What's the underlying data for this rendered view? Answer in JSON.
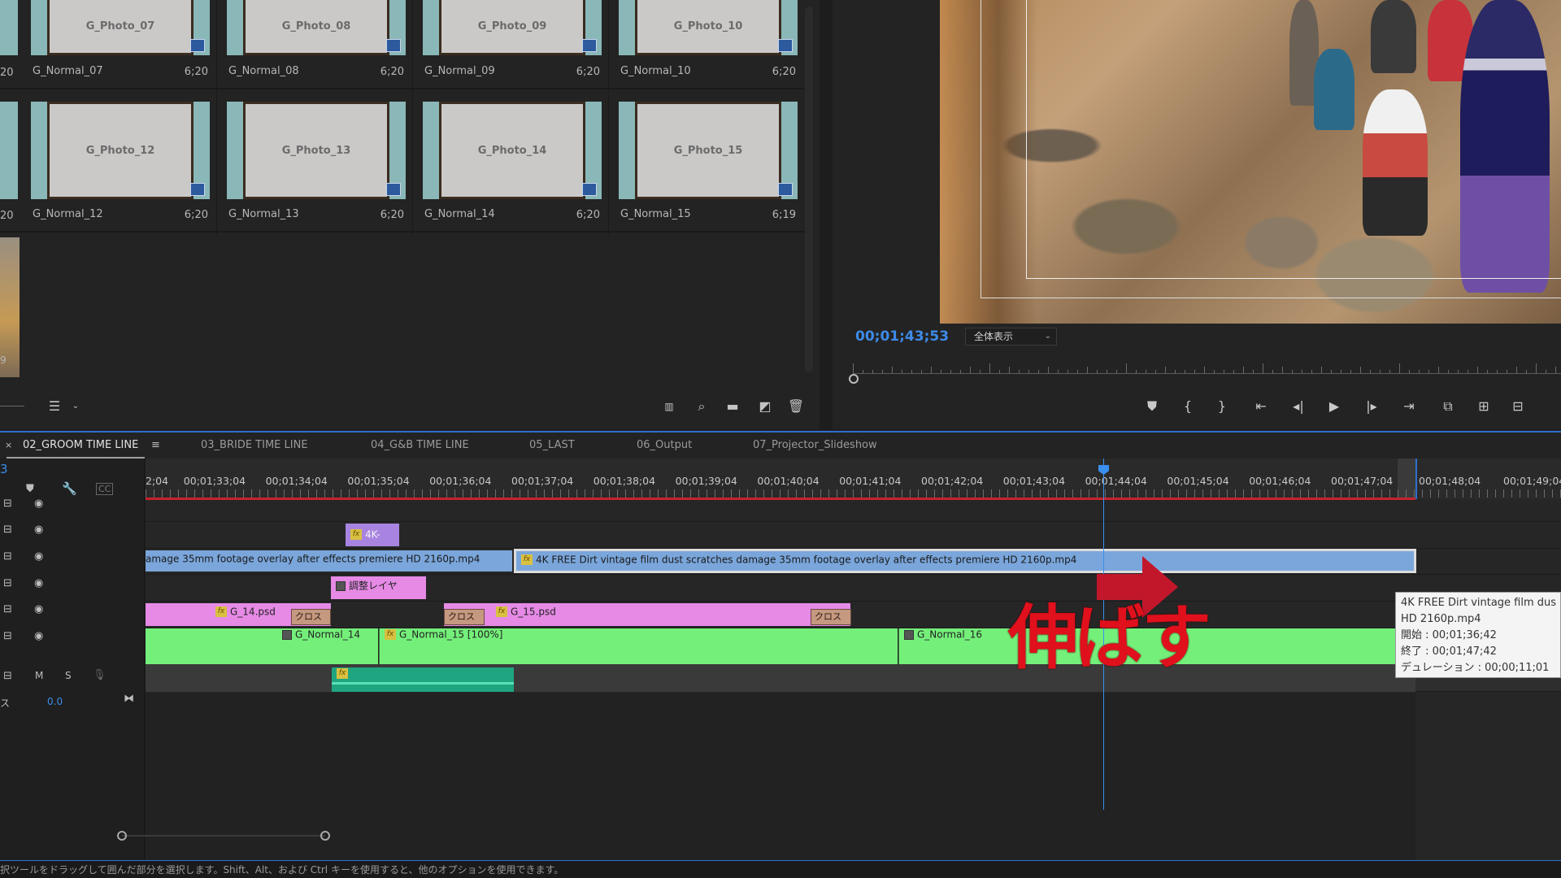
{
  "project_panel": {
    "row1": [
      {
        "photo": "G_Photo_07",
        "name": "G_Normal_07",
        "dur": "6;20"
      },
      {
        "photo": "G_Photo_08",
        "name": "G_Normal_08",
        "dur": "6;20"
      },
      {
        "photo": "G_Photo_09",
        "name": "G_Normal_09",
        "dur": "6;20"
      },
      {
        "photo": "G_Photo_10",
        "name": "G_Normal_10",
        "dur": "6;20"
      }
    ],
    "row2": [
      {
        "photo": "G_Photo_12",
        "name": "G_Normal_12",
        "dur": "6;20"
      },
      {
        "photo": "G_Photo_13",
        "name": "G_Normal_13",
        "dur": "6;20"
      },
      {
        "photo": "G_Photo_14",
        "name": "G_Normal_14",
        "dur": "6;20"
      },
      {
        "photo": "G_Photo_15",
        "name": "G_Normal_15",
        "dur": "6;19"
      }
    ],
    "left_partial": [
      "20",
      "20",
      "9"
    ]
  },
  "program_monitor": {
    "timecode": "00;01;43;53",
    "fit_label": "全体表示"
  },
  "timeline": {
    "tabs": [
      {
        "label": "02_GROOM TIME LINE"
      },
      {
        "label": "03_BRIDE TIME LINE"
      },
      {
        "label": "04_G&B TIME LINE"
      },
      {
        "label": "05_LAST"
      },
      {
        "label": "06_Output"
      },
      {
        "label": "07_Projector_Slideshow"
      }
    ],
    "track_count_label": "3",
    "ruler_labels": [
      "2;04",
      "00;01;33;04",
      "00;01;34;04",
      "00;01;35;04",
      "00;01;36;04",
      "00;01;37;04",
      "00;01;38;04",
      "00;01;39;04",
      "00;01;40;04",
      "00;01;41;04",
      "00;01;42;04",
      "00;01;43;04",
      "00;01;44;04",
      "00;01;45;04",
      "00;01;46;04",
      "00;01;47;04",
      "00;01;48;04",
      "00;01;49;04"
    ],
    "clips": {
      "v6_label": "4K-",
      "v5_left": "amage 35mm footage overlay after effects premiere HD 2160p.mp4",
      "v5_right": "4K FREE Dirt vintage film dust scratches damage 35mm footage overlay after effects premiere HD 2160p.mp4",
      "v4_label": "調整レイヤ",
      "v3_a": "G_14.psd",
      "v3_b": "G_15.psd",
      "trans1": "クロス",
      "trans2": "クロス",
      "trans3": "クロス",
      "v2_a": "G_Normal_14",
      "v2_b": "G_Normal_15 [100%]",
      "v2_c": "G_Normal_16"
    },
    "audio_header": {
      "m": "M",
      "s": "S",
      "volume": "0.0",
      "left_cut": "ス"
    },
    "tooltip": {
      "line1": "4K FREE Dirt vintage film dus",
      "line2": "HD 2160p.mp4",
      "line3": "開始 : 00;01;36;42",
      "line4": "終了 : 00;01;47;42",
      "line5": "デュレーション : 00;00;11;01"
    },
    "annotation": "伸ばす"
  },
  "status_bar": "択ツールをドラッグして囲んだ部分を選択します。Shift、Alt、および Ctrl キーを使用すると、他のオプションを使用できます。",
  "colors": {
    "accent_blue": "#2f6fd0",
    "annotation_red": "#e0101c",
    "clip_green": "#74f07a",
    "clip_pink": "#e68ae6",
    "clip_purple": "#a884e0",
    "clip_blue": "#7aa6db",
    "audio_teal": "#1fa580"
  }
}
